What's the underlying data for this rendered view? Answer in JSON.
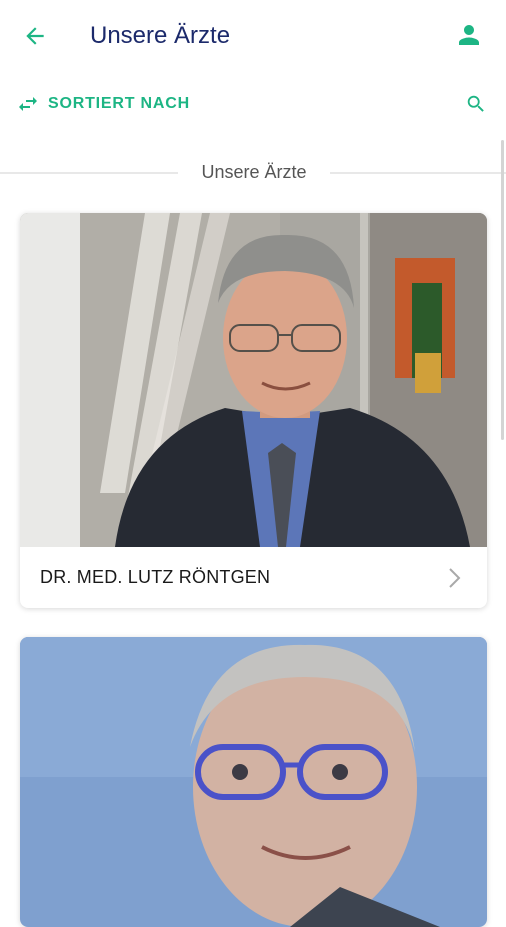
{
  "appbar": {
    "title": "Unsere Ärzte",
    "back_icon": "arrow-left-icon",
    "profile_icon": "person-icon"
  },
  "toolbar": {
    "sort_label": "SORTIERT NACH",
    "sort_icon": "swap-arrows-icon",
    "search_icon": "search-icon"
  },
  "section": {
    "heading": "Unsere Ärzte"
  },
  "doctors": [
    {
      "name": "DR. MED. LUTZ RÖNTGEN"
    },
    {
      "name": ""
    }
  ],
  "colors": {
    "accent": "#1db584",
    "title": "#1c2a6b",
    "text": "#1a1a1a"
  }
}
